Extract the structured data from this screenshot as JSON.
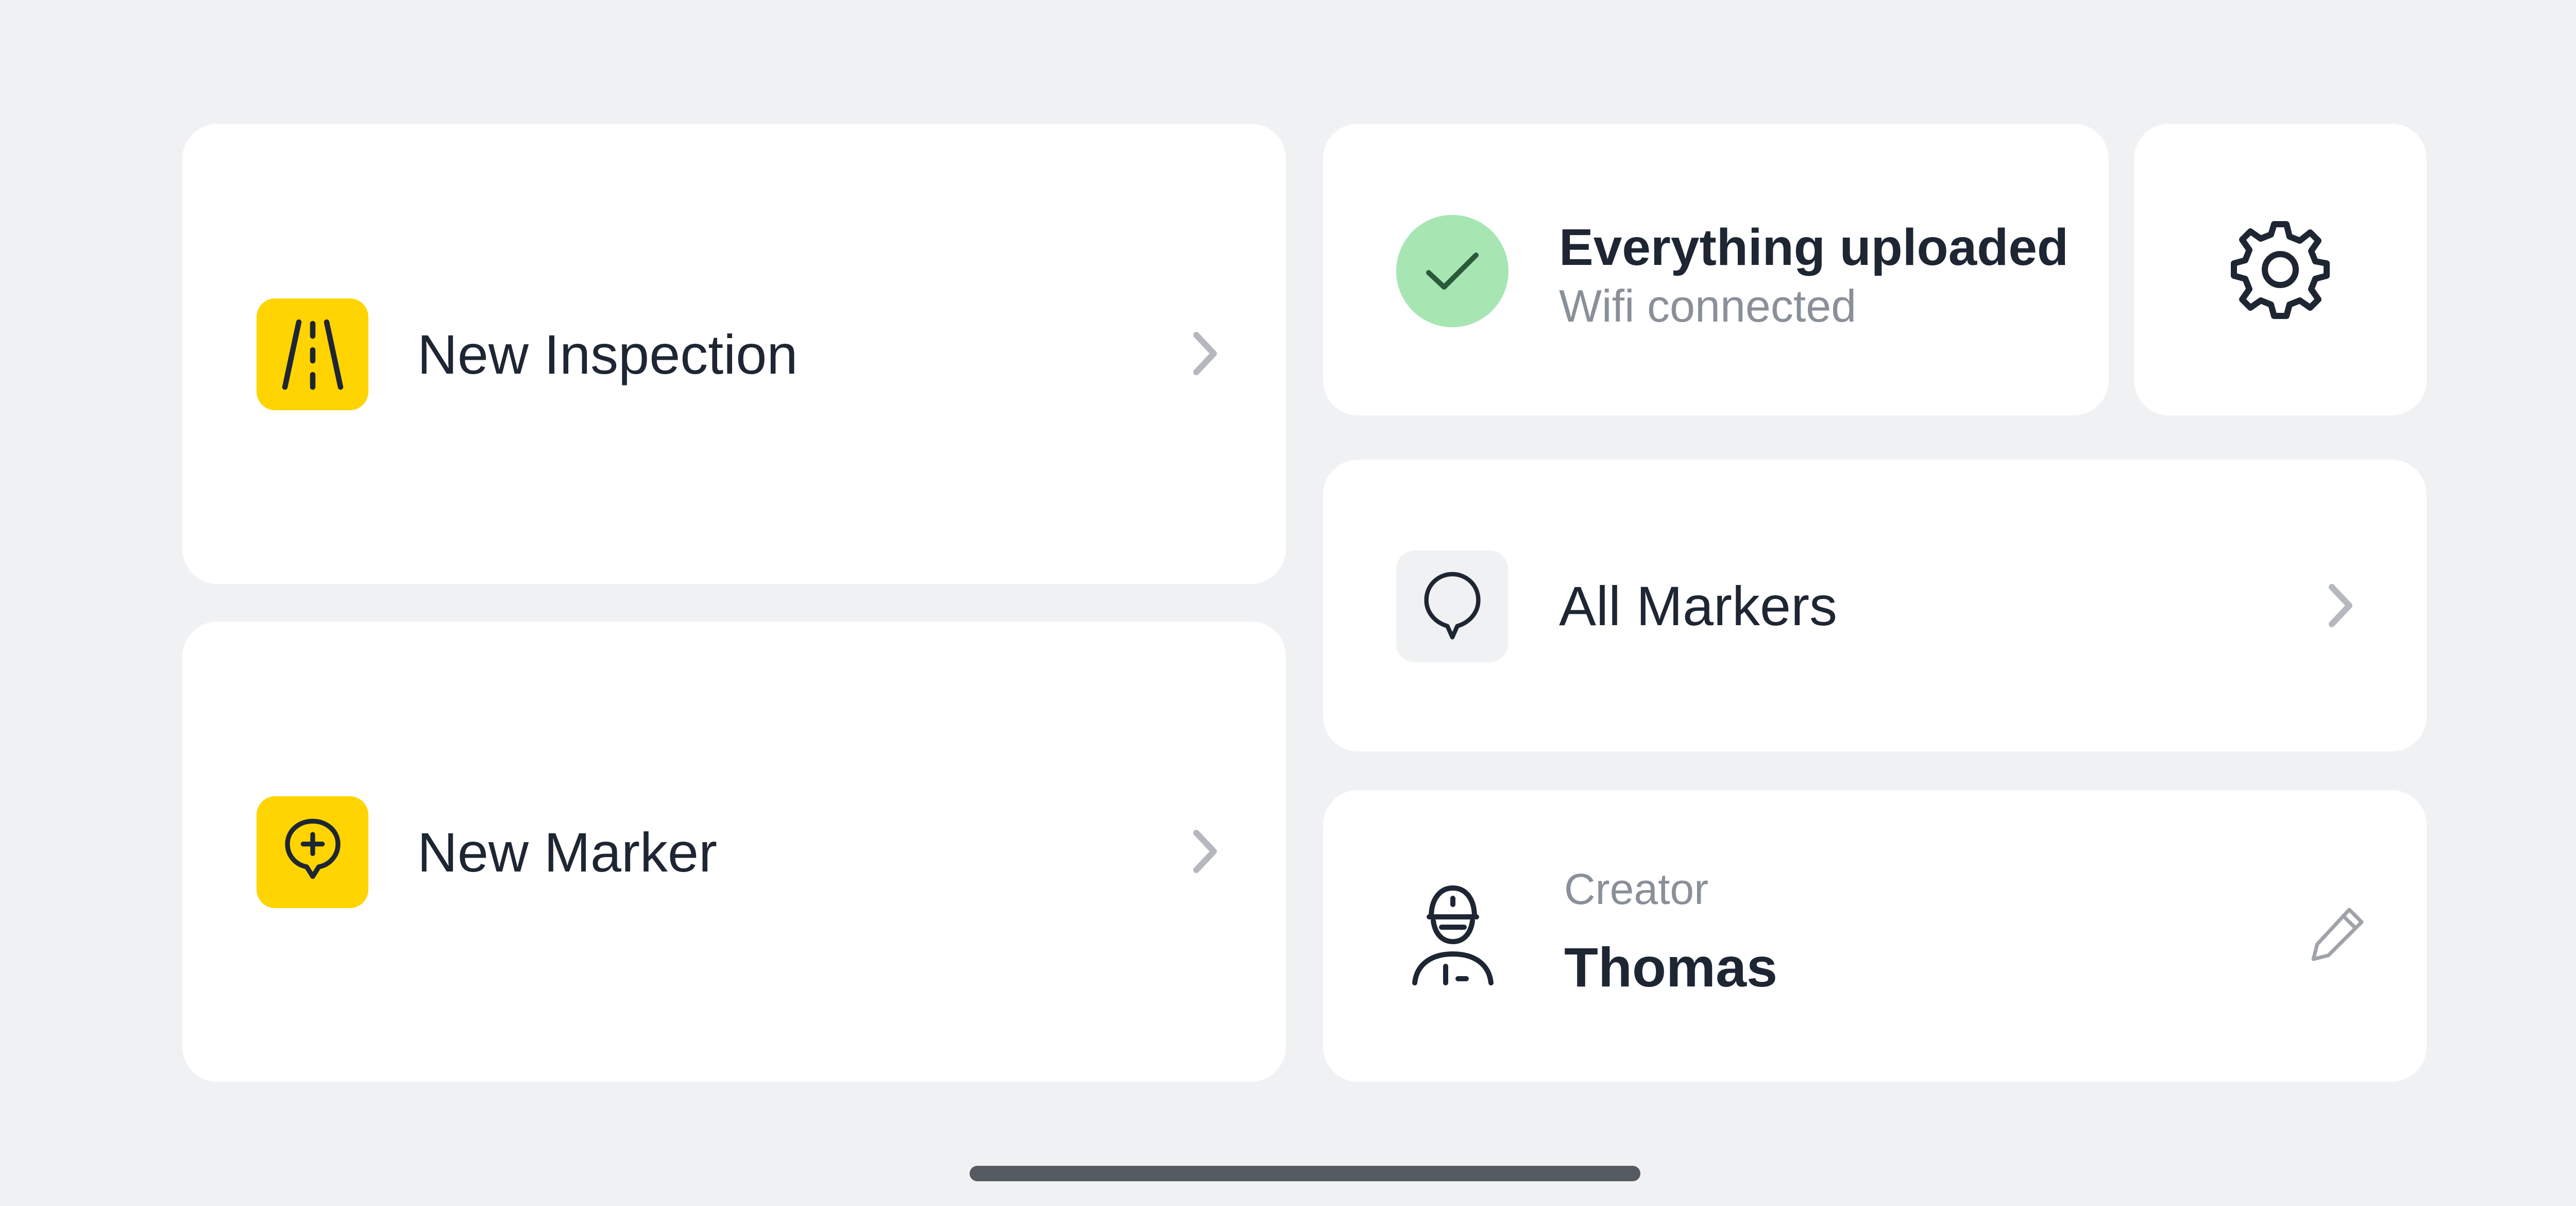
{
  "tiles": {
    "new_inspection": {
      "label": "New Inspection",
      "icon": "road-icon"
    },
    "new_marker": {
      "label": "New Marker",
      "icon": "marker-plus-icon"
    },
    "all_markers": {
      "label": "All Markers",
      "icon": "marker-icon"
    }
  },
  "upload_status": {
    "title": "Everything uploaded",
    "subtitle": "Wifi connected",
    "icon": "checkmark-icon",
    "status_color": "#a7e6b3"
  },
  "settings": {
    "icon": "gear-icon"
  },
  "creator": {
    "role": "Creator",
    "name": "Thomas",
    "avatar_icon": "worker-avatar-icon",
    "edit_icon": "pencil-icon"
  },
  "colors": {
    "accent": "#ffd400",
    "background": "#f0f1f3",
    "card": "#ffffff",
    "text": "#1e2633",
    "muted": "#8a9099"
  }
}
